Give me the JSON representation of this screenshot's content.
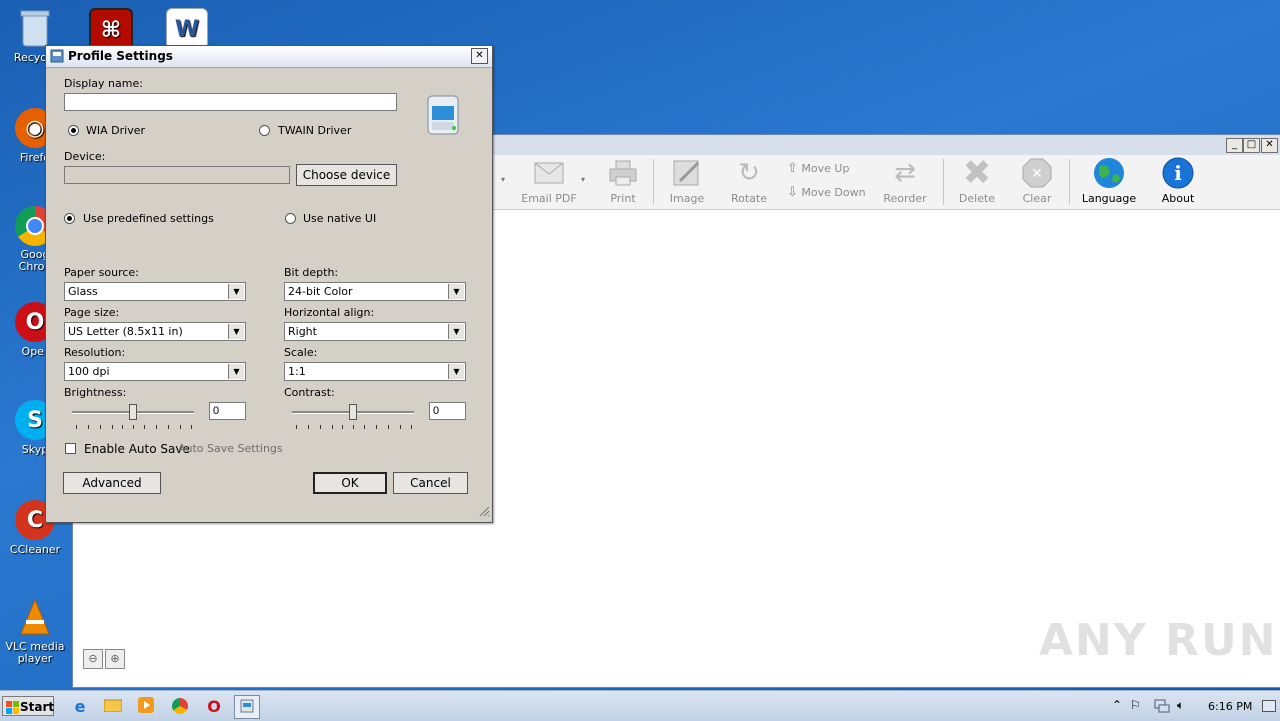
{
  "desktop": {
    "icons": [
      {
        "label": "Recycle",
        "icon": "recycle-bin-icon"
      },
      {
        "label": "",
        "icon": "acrobat-icon"
      },
      {
        "label": "",
        "icon": "word-icon"
      },
      {
        "label": "Firefo",
        "icon": "firefox-icon"
      },
      {
        "label": "Goog\nChron",
        "icon": "chrome-icon"
      },
      {
        "label": "Oper",
        "icon": "opera-icon"
      },
      {
        "label": "Skyp",
        "icon": "skype-icon"
      },
      {
        "label": "CCleaner",
        "icon": "ccleaner-icon"
      },
      {
        "label": "VLC media\nplayer",
        "icon": "vlc-icon"
      }
    ]
  },
  "main_window": {
    "toolbar": [
      {
        "label": "Email PDF",
        "icon": "email-icon",
        "enabled": false
      },
      {
        "label": "Print",
        "icon": "printer-icon",
        "enabled": false
      },
      {
        "label": "Image",
        "icon": "image-edit-icon",
        "enabled": false
      },
      {
        "label": "Rotate",
        "icon": "rotate-icon",
        "enabled": false
      },
      {
        "label": "Move Up",
        "icon": "arrow-up-icon",
        "enabled": false
      },
      {
        "label": "Move Down",
        "icon": "arrow-down-icon",
        "enabled": false
      },
      {
        "label": "Reorder",
        "icon": "reorder-icon",
        "enabled": false
      },
      {
        "label": "Delete",
        "icon": "delete-icon",
        "enabled": false
      },
      {
        "label": "Clear",
        "icon": "clear-icon",
        "enabled": false
      },
      {
        "label": "Language",
        "icon": "globe-icon",
        "enabled": true
      },
      {
        "label": "About",
        "icon": "info-icon",
        "enabled": true
      }
    ]
  },
  "dialog": {
    "title": "Profile Settings",
    "display_name_label": "Display name:",
    "display_name_value": "",
    "wia_label": "WIA Driver",
    "twain_label": "TWAIN Driver",
    "driver_selected": "WIA Driver",
    "device_label": "Device:",
    "device_value": "",
    "choose_device_label": "Choose device",
    "predefined_label": "Use predefined settings",
    "native_ui_label": "Use native UI",
    "paper_source_label": "Paper source:",
    "paper_source_value": "Glass",
    "bit_depth_label": "Bit depth:",
    "bit_depth_value": "24-bit Color",
    "page_size_label": "Page size:",
    "page_size_value": "US Letter (8.5x11 in)",
    "horizontal_align_label": "Horizontal align:",
    "horizontal_align_value": "Right",
    "resolution_label": "Resolution:",
    "resolution_value": "100 dpi",
    "scale_label": "Scale:",
    "scale_value": "1:1",
    "brightness_label": "Brightness:",
    "brightness_value": "0",
    "contrast_label": "Contrast:",
    "contrast_value": "0",
    "auto_save_label": "Enable Auto Save",
    "auto_save_checked": false,
    "auto_save_settings_label": "Auto Save Settings",
    "advanced_label": "Advanced",
    "ok_label": "OK",
    "cancel_label": "Cancel",
    "close_glyph": "✕"
  },
  "taskbar": {
    "start_label": "Start",
    "clock": "6:16 PM",
    "apps": [
      "ie-icon",
      "explorer-icon",
      "media-player-icon",
      "chrome-icon",
      "opera-icon",
      "naps2-icon"
    ]
  },
  "watermark": "ANY RUN"
}
